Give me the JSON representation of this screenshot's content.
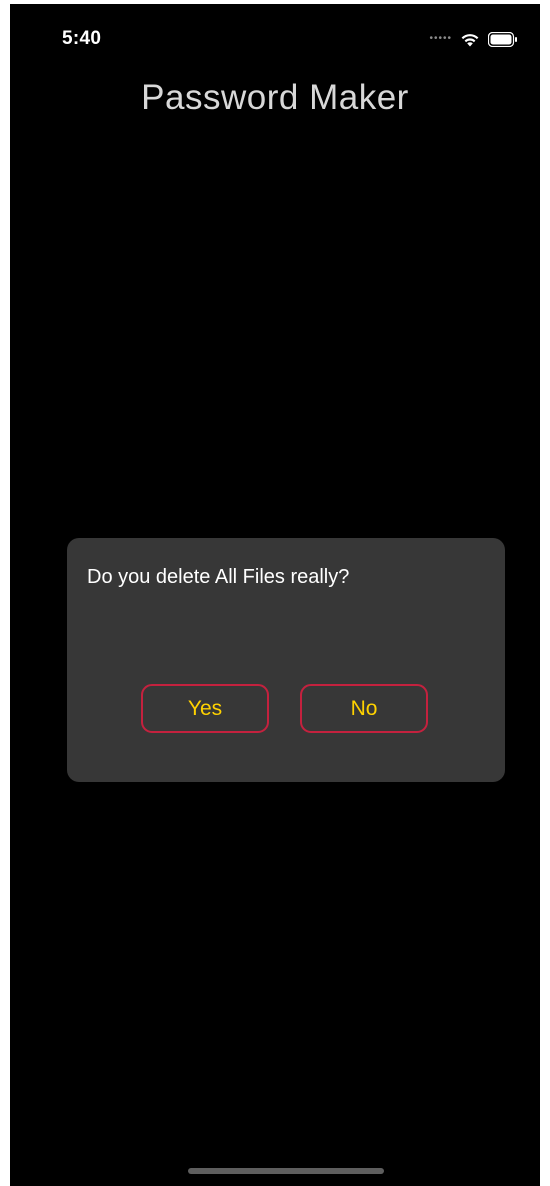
{
  "status_bar": {
    "time": "5:40",
    "signal_icon": "signal-dots-icon",
    "wifi_icon": "wifi-icon",
    "battery_icon": "battery-icon"
  },
  "header": {
    "title": "Password Maker"
  },
  "dialog": {
    "message": "Do you delete All Files really?",
    "yes_label": "Yes",
    "no_label": "No"
  },
  "colors": {
    "background": "#000000",
    "dialog_background": "#373737",
    "button_border": "#c4213e",
    "button_text": "#ffd200",
    "title_text": "#d8d8d8"
  }
}
